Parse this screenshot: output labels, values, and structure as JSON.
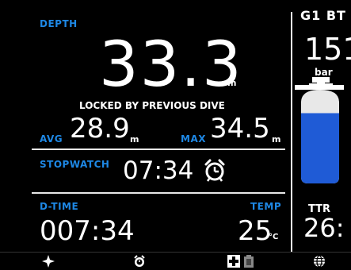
{
  "depth": {
    "label": "DEPTH",
    "value": "33.3",
    "unit": "m",
    "status": "LOCKED BY PREVIOUS DIVE"
  },
  "avg": {
    "label": "AVG",
    "value": "28.9",
    "unit": "m"
  },
  "max": {
    "label": "MAX",
    "value": "34.5",
    "unit": "m"
  },
  "stopwatch": {
    "label": "STOPWATCH",
    "value": "07:34",
    "icon": "alarm-clock-icon"
  },
  "dtime": {
    "label": "D-TIME",
    "value": "007:34"
  },
  "temp": {
    "label": "TEMP",
    "value": "25",
    "unit": "°C"
  },
  "gas": {
    "title": "G1 BT",
    "pressure": "151",
    "pressure_unit": "bar",
    "tank_fill": 0.75,
    "tank_color": "#1f5bd6"
  },
  "ttr": {
    "label": "TTR",
    "value": "26:"
  },
  "toolbar": {
    "icons": [
      "compass-icon",
      "alarm-clock-icon",
      "plus-icon",
      "battery-icon",
      "globe-icon"
    ]
  },
  "colors": {
    "accent": "#1e88e5",
    "background": "#000000",
    "divider": "#e8e8e8"
  }
}
